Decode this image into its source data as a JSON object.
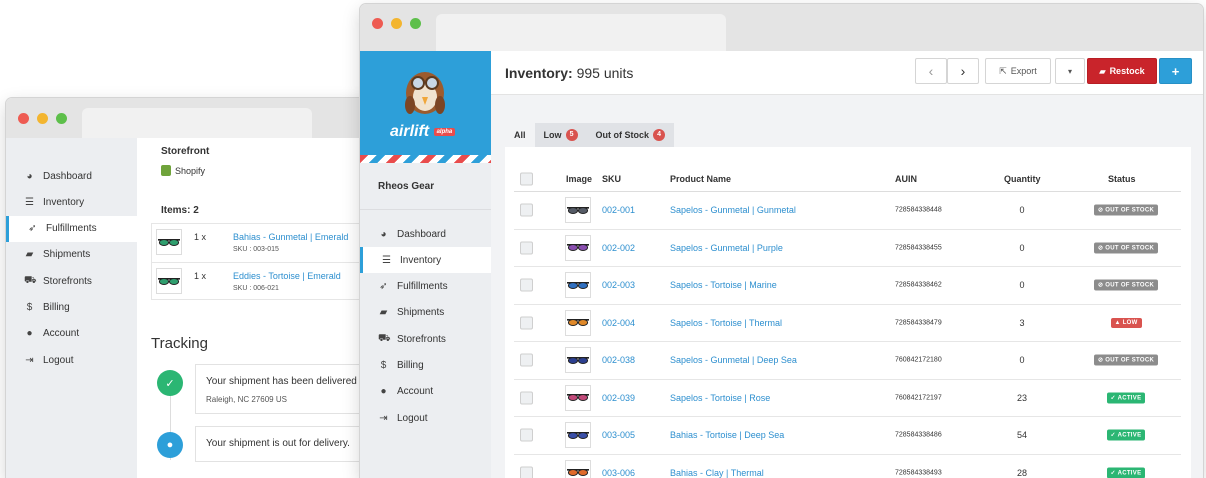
{
  "back_window": {
    "sidebar": [
      {
        "icon": "dashboard-icon",
        "glyph": "◕",
        "label": "Dashboard"
      },
      {
        "icon": "list-icon",
        "glyph": "☰",
        "label": "Inventory"
      },
      {
        "icon": "paper-plane-icon",
        "glyph": "➶",
        "label": "Fulfillments",
        "active": true
      },
      {
        "icon": "truck-icon",
        "glyph": "▰",
        "label": "Shipments"
      },
      {
        "icon": "cart-icon",
        "glyph": "⛟",
        "label": "Storefronts"
      },
      {
        "icon": "dollar-icon",
        "glyph": "$",
        "label": "Billing"
      },
      {
        "icon": "user-icon",
        "glyph": "●",
        "label": "Account"
      },
      {
        "icon": "logout-icon",
        "glyph": "⇥",
        "label": "Logout"
      }
    ],
    "storefront_heading": "Storefront",
    "storefront_name": "Shopify",
    "items_heading": "Items: 2",
    "items": [
      {
        "qty": "1 x",
        "name": "Bahias - Gunmetal | Emerald",
        "sku": "SKU : 003-015",
        "lens": "#2f9e6e"
      },
      {
        "qty": "1 x",
        "name": "Eddies - Tortoise | Emerald",
        "sku": "SKU : 006-021",
        "lens": "#2f9e6e"
      }
    ],
    "tracking_heading": "Tracking",
    "tracking": [
      {
        "text": "Your shipment has been delivered a",
        "location": "Raleigh, NC 27609 US"
      },
      {
        "text": "Your shipment is out for delivery.",
        "location": ""
      }
    ]
  },
  "front_window": {
    "brand": {
      "name": "airlift",
      "tag": "alpha"
    },
    "account_name": "Rheos Gear",
    "sidebar": [
      {
        "icon": "dashboard-icon",
        "glyph": "◕",
        "label": "Dashboard"
      },
      {
        "icon": "list-icon",
        "glyph": "☰",
        "label": "Inventory",
        "active": true
      },
      {
        "icon": "paper-plane-icon",
        "glyph": "➶",
        "label": "Fulfillments"
      },
      {
        "icon": "truck-icon",
        "glyph": "▰",
        "label": "Shipments"
      },
      {
        "icon": "cart-icon",
        "glyph": "⛟",
        "label": "Storefronts"
      },
      {
        "icon": "dollar-icon",
        "glyph": "$",
        "label": "Billing"
      },
      {
        "icon": "user-icon",
        "glyph": "●",
        "label": "Account"
      },
      {
        "icon": "logout-icon",
        "glyph": "⇥",
        "label": "Logout"
      }
    ],
    "title_prefix": "Inventory:",
    "title_value": "995 units",
    "toolbar": {
      "prev": "‹",
      "next": "›",
      "export": "Export",
      "caret": "▾",
      "restock": "Restock",
      "add": "+"
    },
    "tabs": [
      {
        "label": "All",
        "count": null
      },
      {
        "label": "Low",
        "count": "5"
      },
      {
        "label": "Out of Stock",
        "count": "4"
      }
    ],
    "columns": {
      "image": "Image",
      "sku": "SKU",
      "name": "Product Name",
      "auin": "AUIN",
      "qty": "Quantity",
      "status": "Status"
    },
    "rows": [
      {
        "sku": "002-001",
        "name": "Sapelos - Gunmetal | Gunmetal",
        "auin": "728584338448",
        "qty": "0",
        "status": "OUT OF STOCK",
        "status_key": "oos",
        "lens": "#555b66"
      },
      {
        "sku": "002-002",
        "name": "Sapelos - Gunmetal | Purple",
        "auin": "728584338455",
        "qty": "0",
        "status": "OUT OF STOCK",
        "status_key": "oos",
        "lens": "#8a4fb0"
      },
      {
        "sku": "002-003",
        "name": "Sapelos - Tortoise | Marine",
        "auin": "728584338462",
        "qty": "0",
        "status": "OUT OF STOCK",
        "status_key": "oos",
        "lens": "#2f6fc0"
      },
      {
        "sku": "002-004",
        "name": "Sapelos - Tortoise | Thermal",
        "auin": "728584338479",
        "qty": "3",
        "status": "LOW",
        "status_key": "low",
        "lens": "#e0892a"
      },
      {
        "sku": "002-038",
        "name": "Sapelos - Gunmetal | Deep Sea",
        "auin": "760842172180",
        "qty": "0",
        "status": "OUT OF STOCK",
        "status_key": "oos",
        "lens": "#2c3f8f"
      },
      {
        "sku": "002-039",
        "name": "Sapelos - Tortoise | Rose",
        "auin": "760842172197",
        "qty": "23",
        "status": "ACTIVE",
        "status_key": "act",
        "lens": "#c24a7a"
      },
      {
        "sku": "003-005",
        "name": "Bahias - Tortoise | Deep Sea",
        "auin": "728584338486",
        "qty": "54",
        "status": "ACTIVE",
        "status_key": "act",
        "lens": "#3a4fa8"
      },
      {
        "sku": "003-006",
        "name": "Bahias - Clay | Thermal",
        "auin": "728584338493",
        "qty": "28",
        "status": "ACTIVE",
        "status_key": "act",
        "lens": "#e06a2a"
      }
    ]
  }
}
